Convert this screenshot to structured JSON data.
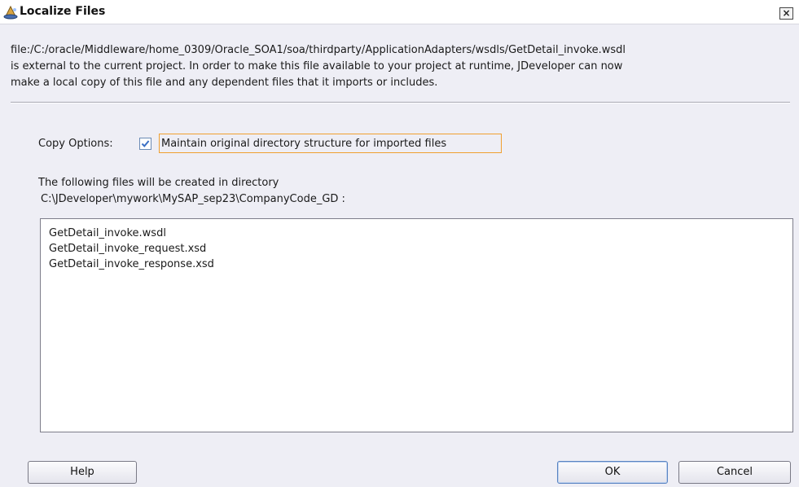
{
  "window": {
    "title": "Localize Files",
    "close_glyph": "×"
  },
  "message": {
    "lines": [
      "file:/C:/oracle/Middleware/home_0309/Oracle_SOA1/soa/thirdparty/ApplicationAdapters/wsdls/GetDetail_invoke.wsdl",
      "is external to the current project. In order to make this file available to your project at runtime, JDeveloper can now",
      "make a local copy of this file and any dependent files that it imports or includes."
    ]
  },
  "copy_options": {
    "label": "Copy Options:",
    "checkbox_label": "Maintain original directory structure for imported files",
    "checked": true
  },
  "directory": {
    "intro": "The following files will be created in directory",
    "path": "C:\\JDeveloper\\mywork\\MySAP_sep23\\CompanyCode_GD :"
  },
  "files": [
    "GetDetail_invoke.wsdl",
    "GetDetail_invoke_request.xsd",
    "GetDetail_invoke_response.xsd"
  ],
  "buttons": {
    "help": "Help",
    "ok": "OK",
    "cancel": "Cancel"
  },
  "icons": {
    "title": "wizard-hat-icon",
    "check": "checkmark-icon"
  },
  "colors": {
    "dialog_bg": "#eeeef5",
    "focus_border": "#f0a030",
    "check": "#3a6fc4"
  }
}
